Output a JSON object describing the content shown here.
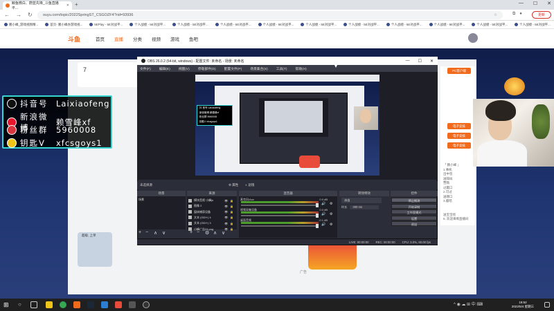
{
  "browser": {
    "tab_title": "鲸鱼微白、蔚蓝先锋_斗鱼直播平...",
    "url": "ouyu.com/topic/2022SpringST_CSGOZF4?rid=93936",
    "update_label": "更新",
    "bookmarks": [
      "鹏小峰_游戏视频精...",
      "首页- 鹏小峰办游戏视...",
      "5EPlay - 5E对战平...",
      "个人战绩 - 5E对战平...",
      "个人战绩 - 5E对战平...",
      "个人战绩 - 5E对战平...",
      "个人战绩 - 5E对战平...",
      "个人战绩 - 5E对战平...",
      "个人战绩 - 5E对战平...",
      "个人战绩 - 5E对战平...",
      "个人战绩 - 5E对战平...",
      "个人战绩 - 5E对战平...",
      "个人战绩 - 5E对战平..."
    ]
  },
  "site": {
    "logo": "斗鱼",
    "nav": [
      "首页",
      "直播",
      "分类",
      "视频",
      "游戏",
      "鱼吧"
    ],
    "left_number": "7",
    "ad_label": "广告",
    "promo_label": "超级, 上单",
    "right_buttons": [
      "PC客户端",
      "电子竞技",
      "电子竞技",
      "电子竞技"
    ],
    "right_text": [
      "「 鹏小峰 」",
      "1.事机",
      "出中签",
      "送隔局",
      "蕈隋  ",
      "过赢口",
      "2.可过",
      "送哪口",
      "3.蹙暗",
      " ",
      " ",
      "送宝宝喷",
      "5. 欢迎来啊直播间"
    ]
  },
  "overlay": {
    "rows": [
      {
        "label": "抖音号",
        "value": "Laixiaofeng",
        "color": "#111111"
      },
      {
        "label": "新浪微博",
        "value": "赖雪峰xf",
        "color": "#e6162d"
      },
      {
        "label": "粉丝群",
        "value": "5960008",
        "color": "#d9363e"
      },
      {
        "label": "钥匙V",
        "value": "xfcsgoys1",
        "color": "#f0c419"
      }
    ]
  },
  "obs": {
    "title": "OBS 26.0.2 (64-bit, windows) - 配置文件: 未命名 - 场景: 未命名",
    "menu": [
      "文件(F)",
      "编辑(E)",
      "视图(V)",
      "停靠部件(D)",
      "配置文件(P)",
      "场景集合(S)",
      "工具(T)",
      "帮助(H)"
    ],
    "scene_status": "未选择源",
    "scene_props": [
      "属性",
      "滤镜"
    ],
    "docks": {
      "scenes": "场景",
      "sources": "来源",
      "mixer": "混音器",
      "transitions": "转场特效",
      "controls": "控件"
    },
    "scene_items": [
      "场景"
    ],
    "source_items": [
      "模块音视 小峰ju",
      "图像 2",
      "窗体捕获设备",
      "文本 (GDI+) 4",
      "文本 (GDI+) 3",
      "小峰广告24.png"
    ],
    "mixer_items": [
      {
        "name": "麦克风/Aux",
        "db": "0.0 dB"
      },
      {
        "name": "视频采集设备",
        "db": "0.0 dB"
      },
      {
        "name": "桌面音频",
        "db": "-0.1 dB"
      }
    ],
    "transition_select": "淡出",
    "duration_label": "时长",
    "duration_value": "300 ms",
    "control_buttons": [
      "停止推流",
      "开始录制",
      "工作室模式",
      "设置",
      "退出"
    ],
    "status_items": [
      "LIVE: 00:00:00",
      "REC: 00:00:00",
      "CPU: 3.0%, 60.00 fps"
    ],
    "preview_overlay": [
      "抖 音号 Laixiaofeng",
      "新浪微博 赖雪峰xf",
      "粉丝群 5960008",
      "钥匙V xfcsgoys1"
    ]
  },
  "taskbar": {
    "time": "18:52",
    "date": "2022/5/4 星期三",
    "tray": "^ ◉ ☁ ⊞ 中 ⌨"
  }
}
